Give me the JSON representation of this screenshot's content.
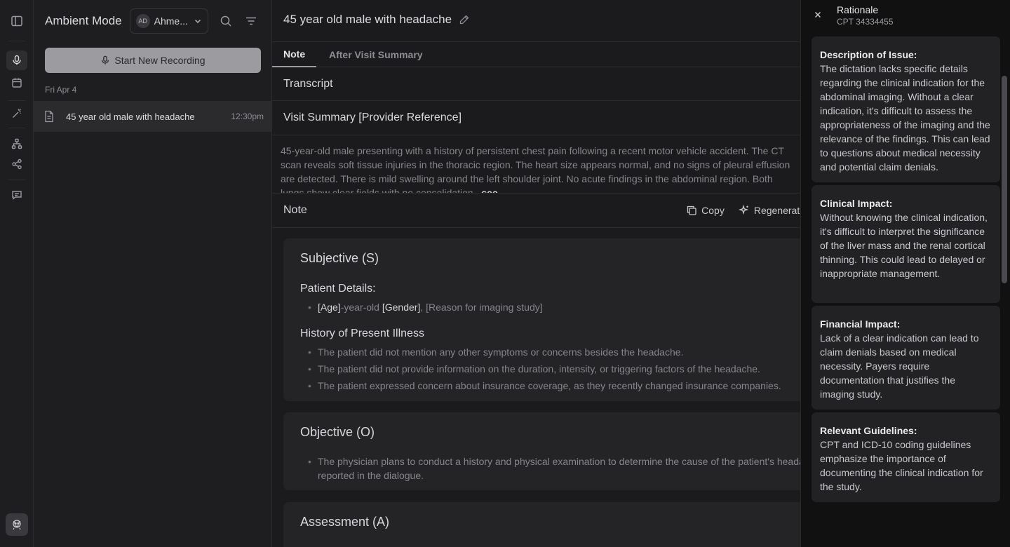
{
  "rail": {
    "icons": [
      "sidebar-toggle-icon",
      "microphone-icon",
      "calendar-icon",
      "magic-wand-icon",
      "hierarchy-icon",
      "share-icon",
      "message-icon"
    ],
    "avatar": "user-avatar"
  },
  "list": {
    "app_title": "Ambient Mode",
    "user": {
      "initials": "AD",
      "name": "Ahme..."
    },
    "record_button": "Start New Recording",
    "date_group": "Fri Apr 4",
    "items": [
      {
        "title": "45 year old male with headache",
        "time": "12:30pm"
      }
    ]
  },
  "main": {
    "title": "45 year old male with headache",
    "tabs": [
      {
        "label": "Note",
        "active": true
      },
      {
        "label": "After Visit Summary",
        "active": false
      }
    ],
    "transcript_label": "Transcript",
    "visit_summary_label": "Visit Summary [Provider Reference]",
    "summary_text": "45-year-old male presenting with a history of persistent chest pain following a recent motor vehicle accident. The CT scan reveals soft tissue injuries in the thoracic region. The heart size appears normal, and no signs of pleural effusion are detected. There is mild swelling around the left shoulder joint. No acute findings in the abdominal region. Both lungs show clear fields with no consolidation..",
    "see_more": "see",
    "note_label": "Note",
    "copy_label": "Copy",
    "regenerate_label": "Regenerate",
    "subjective": {
      "heading": "Subjective (S)",
      "patient_details_heading": "Patient Details:",
      "patient_details": {
        "age": "[Age]",
        "mid": "-year-old ",
        "gender": "[Gender]",
        "rest": ", [Reason for imaging study]"
      },
      "hpi_heading": "History of Present Illness",
      "hpi": [
        "The patient did not mention any other symptoms or concerns besides the headache.",
        "The patient did not provide information on the duration, intensity, or triggering factors of the headache.",
        "The patient expressed concern about insurance coverage, as they recently changed insurance companies."
      ]
    },
    "objective": {
      "heading": "Objective (O)",
      "items": [
        "The physician plans to conduct a history and physical examination to determine the cause of the patient's headache, as",
        "reported in the dialogue."
      ]
    },
    "assessment": {
      "heading": "Assessment (A)"
    }
  },
  "rationale": {
    "title": "Rationale",
    "subtitle": "CPT 34334455",
    "cards": [
      {
        "heading": "Description of Issue:",
        "body": "The dictation lacks specific details regarding the clinical indication for the abdominal imaging. Without a clear indication, it's difficult to assess the appropriateness of the imaging and the relevance of the findings. This can lead to questions about medical necessity and potential claim denials."
      },
      {
        "heading": "Clinical Impact:",
        "body": "Without knowing the clinical indication, it's difficult to interpret the significance of the liver mass and the renal cortical thinning. This could lead to delayed or inappropriate management."
      },
      {
        "heading": "Financial Impact:",
        "body": "Lack of a clear indication can lead to claim denials based on medical necessity. Payers require documentation that justifies the imaging study."
      },
      {
        "heading": "Relevant Guidelines:",
        "body": "CPT and ICD-10 coding guidelines emphasize the importance of documenting the clinical indication for the study."
      }
    ]
  }
}
